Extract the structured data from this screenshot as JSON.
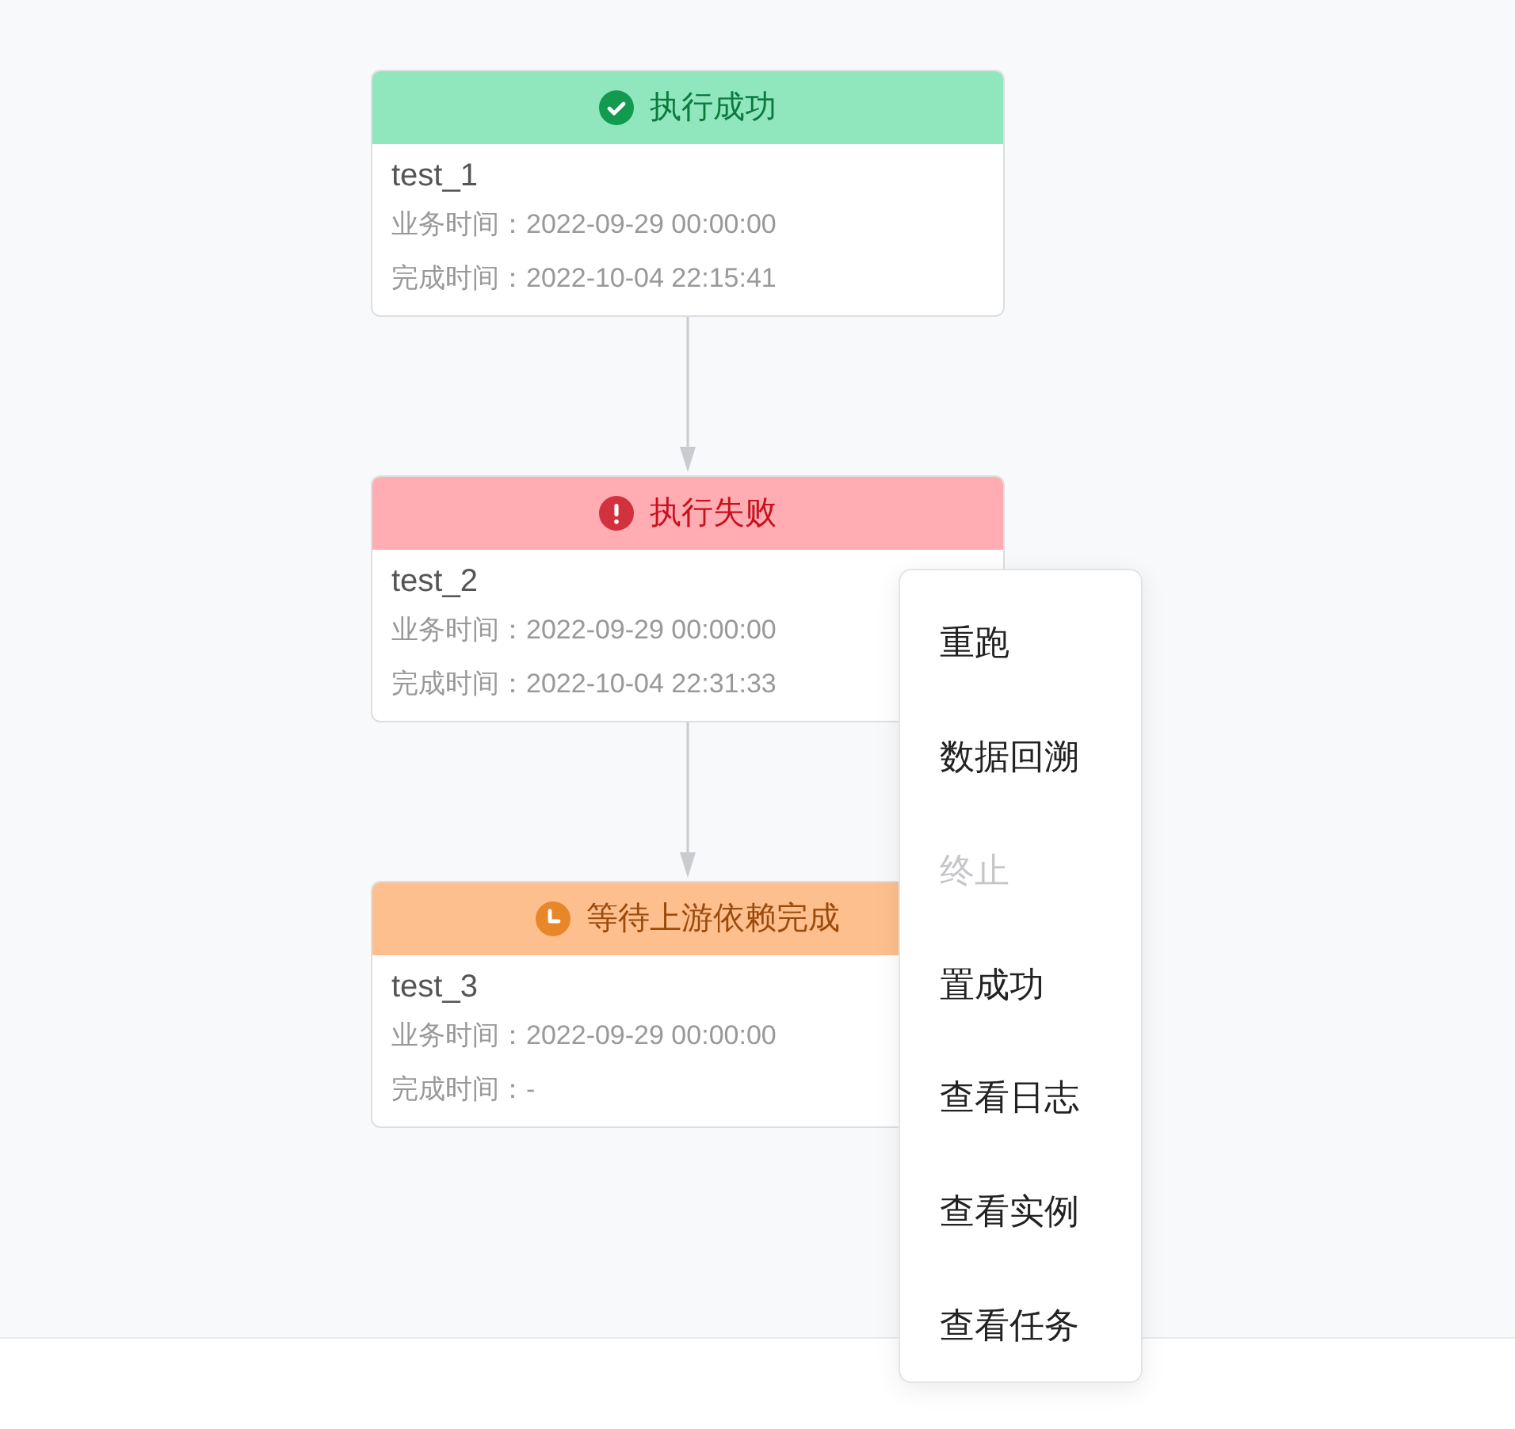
{
  "nodes": [
    {
      "status": {
        "kind": "success",
        "label": "执行成功"
      },
      "name": "test_1",
      "details": [
        "业务时间：2022-09-29 00:00:00",
        "完成时间：2022-10-04 22:15:41"
      ]
    },
    {
      "status": {
        "kind": "failed",
        "label": "执行失败"
      },
      "name": "test_2",
      "details": [
        "业务时间：2022-09-29 00:00:00",
        "完成时间：2022-10-04 22:31:33"
      ]
    },
    {
      "status": {
        "kind": "waiting",
        "label": "等待上游依赖完成"
      },
      "name": "test_3",
      "details": [
        "业务时间：2022-09-29 00:00:00",
        "完成时间：-"
      ]
    }
  ],
  "context_menu": [
    {
      "label": "重跑",
      "disabled": false
    },
    {
      "label": "数据回溯",
      "disabled": false
    },
    {
      "label": "终止",
      "disabled": true
    },
    {
      "label": "置成功",
      "disabled": false
    },
    {
      "label": "查看日志",
      "disabled": false
    },
    {
      "label": "查看实例",
      "disabled": false
    },
    {
      "label": "查看任务",
      "disabled": false
    }
  ]
}
